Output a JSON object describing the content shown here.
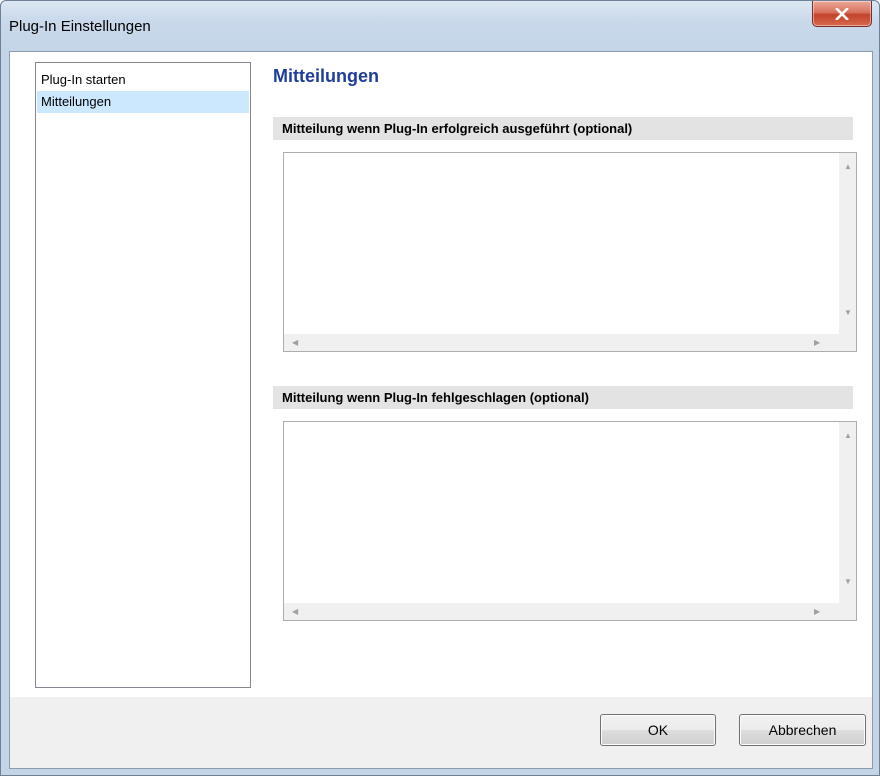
{
  "window": {
    "title": "Plug-In Einstellungen"
  },
  "sidebar": {
    "items": [
      {
        "label": "Plug-In starten",
        "selected": false
      },
      {
        "label": "Mitteilungen",
        "selected": true
      }
    ]
  },
  "main": {
    "title": "Mitteilungen",
    "sections": [
      {
        "header": "Mitteilung wenn Plug-In erfolgreich ausgeführt (optional)",
        "value": ""
      },
      {
        "header": "Mitteilung wenn Plug-In fehlgeschlagen (optional)",
        "value": ""
      }
    ]
  },
  "footer": {
    "ok_label": "OK",
    "cancel_label": "Abbrechen"
  },
  "colors": {
    "title_accent": "#1f3e9b",
    "selection": "#cce8ff",
    "close_button": "#c7442b"
  },
  "icons": {
    "close": "close-icon",
    "scroll_up": "scroll-up-icon",
    "scroll_down": "scroll-down-icon",
    "scroll_left": "scroll-left-icon",
    "scroll_right": "scroll-right-icon"
  }
}
